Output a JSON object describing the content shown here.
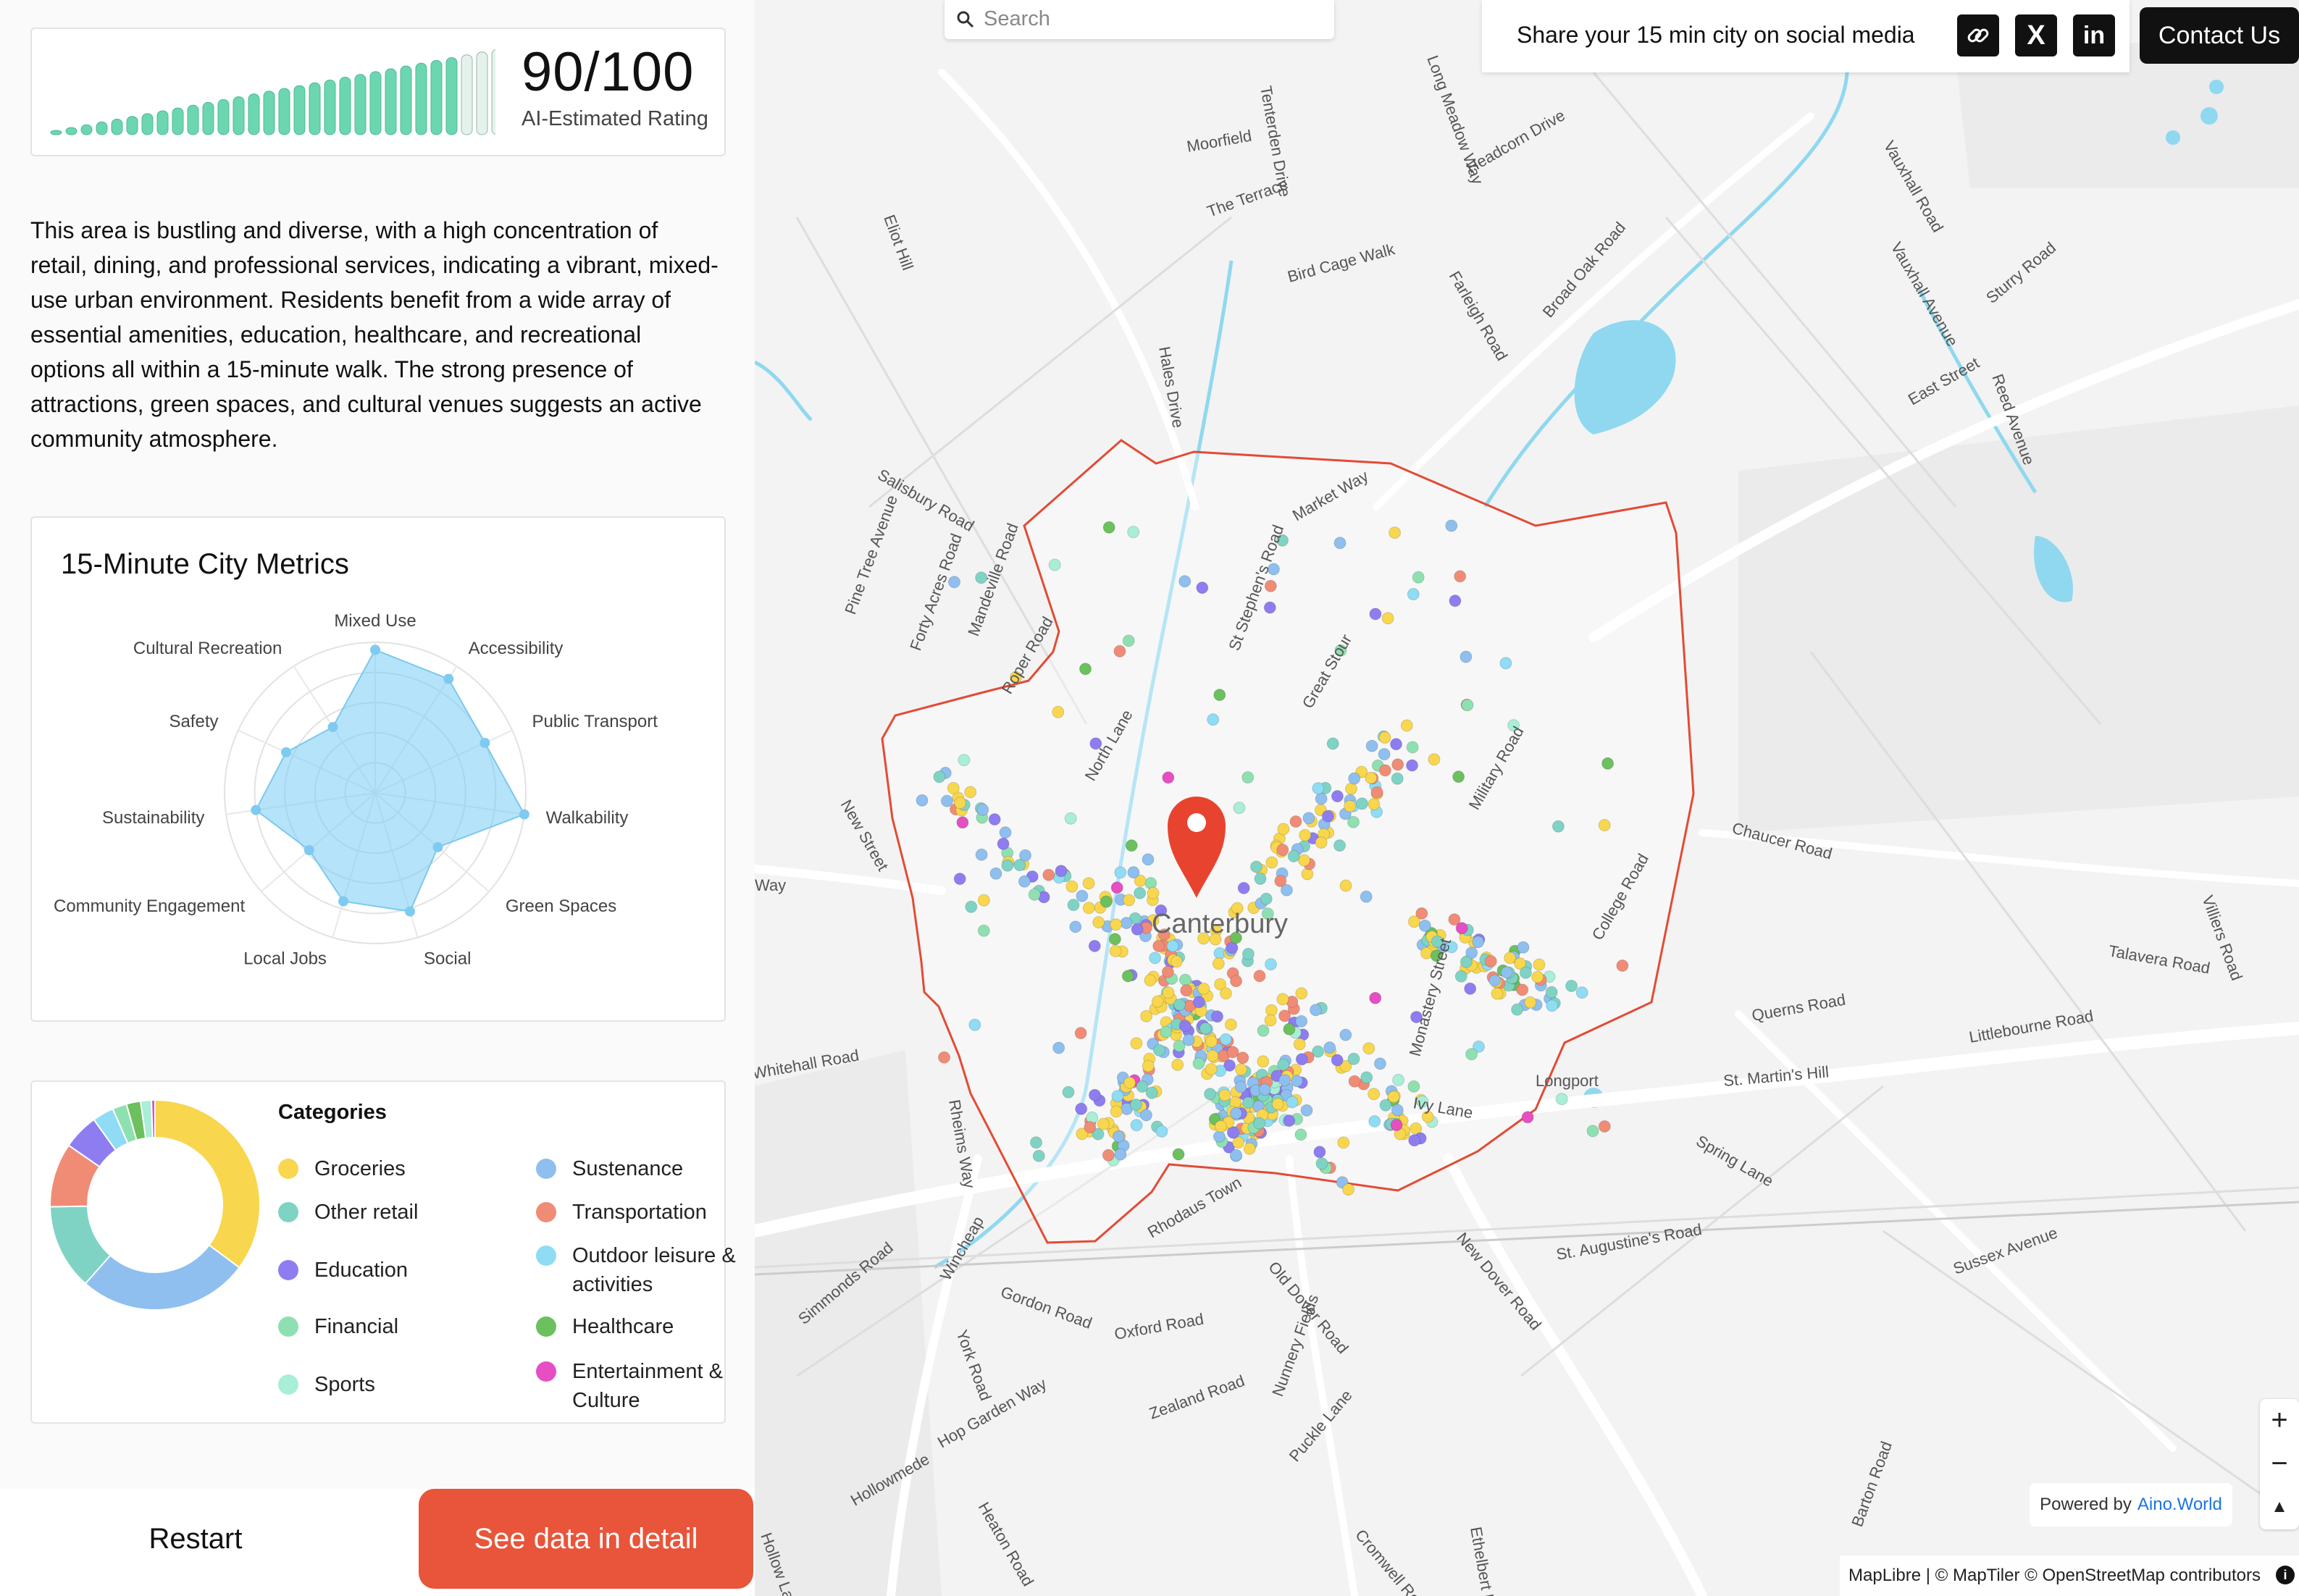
{
  "rating": {
    "score": "90/100",
    "label": "AI-Estimated Rating",
    "bars_filled_fraction": 0.9
  },
  "description": "This area is bustling and diverse, with a high concentration of retail, dining, and professional services, indicating a vibrant, mixed-use urban environment. Residents benefit from a wide array of essential amenities, education, healthcare, and recreational options all within a 15-minute walk. The strong presence of attractions, green spaces, and cultural venues suggests an active community atmosphere.",
  "chart_data": [
    {
      "type": "radar",
      "title": "15-Minute City Metrics",
      "categories": [
        "Mixed Use",
        "Accessibility",
        "Public Transport",
        "Walkability",
        "Green Spaces",
        "Social",
        "Local Jobs",
        "Community Engagement",
        "Sustainability",
        "Safety",
        "Cultural Recreation"
      ],
      "values": [
        0.95,
        0.9,
        0.8,
        1.0,
        0.55,
        0.82,
        0.75,
        0.58,
        0.8,
        0.65,
        0.52
      ],
      "range": [
        0,
        1
      ]
    },
    {
      "type": "pie",
      "title": "Categories",
      "categories": [
        "Groceries",
        "Sustenance",
        "Other retail",
        "Transportation",
        "Education",
        "Outdoor leisure & activities",
        "Financial",
        "Healthcare",
        "Sports",
        "Entertainment & Culture"
      ],
      "values": [
        32,
        24,
        12,
        9,
        5,
        3,
        2,
        2,
        1.5,
        0.5
      ],
      "colors": [
        "#f8d64e",
        "#8ebfee",
        "#7fd3c4",
        "#f08c76",
        "#8e7df0",
        "#8fdcf4",
        "#8fe0b0",
        "#6cc05e",
        "#a9eed6",
        "#e54fc3"
      ]
    }
  ],
  "categories_legend": [
    {
      "label": "Groceries",
      "color": "#f8d64e"
    },
    {
      "label": "Sustenance",
      "color": "#8ebfee"
    },
    {
      "label": "Other retail",
      "color": "#7fd3c4"
    },
    {
      "label": "Transportation",
      "color": "#f08c76"
    },
    {
      "label": "Education",
      "color": "#8e7df0"
    },
    {
      "label": "Outdoor leisure & activities",
      "color": "#8fdcf4"
    },
    {
      "label": "Financial",
      "color": "#8fe0b0"
    },
    {
      "label": "Healthcare",
      "color": "#6cc05e"
    },
    {
      "label": "Sports",
      "color": "#a9eed6"
    },
    {
      "label": "Entertainment & Culture",
      "color": "#e54fc3"
    }
  ],
  "buttons": {
    "restart": "Restart",
    "detail": "See data in detail",
    "contact": "Contact Us"
  },
  "search": {
    "placeholder": "Search"
  },
  "share": {
    "text": "Share your 15 min city on social media",
    "x_icon": "X",
    "linkedin_icon": "in"
  },
  "map": {
    "city_label": "Canterbury",
    "streets": [
      "Moorfield",
      "The Terrace",
      "Bird Cage Walk",
      "Tenterden Drive",
      "Long Meadow Way",
      "Headcorn Drive",
      "Farleigh Road",
      "Broad Oak Road",
      "Eliot Hill",
      "Hales Drive",
      "Salisbury Road",
      "Vauxhall Road",
      "Vauxhall Avenue",
      "Sturry Road",
      "Reed Avenue",
      "East Street",
      "Market Way",
      "St Stephen's Road",
      "Forty Acres Road",
      "Mandeville Road",
      "Pine Tree Avenue",
      "Roper Road",
      "North Lane",
      "New Street",
      "Chaucer Road",
      "Villiers Road",
      "Military Road",
      "College Road",
      "Talavera Road",
      "Querns Road",
      "Whitehall Road",
      "Rheims Way",
      "Monastery Street",
      "Littlebourne Road",
      "St. Martin's Hill",
      "Ivy Lane",
      "Longport",
      "Spring Lane",
      "Sussex Avenue",
      "New Dover Road",
      "St. Augustine's Road",
      "Rhodaus Town",
      "Old Dover Road",
      "Gordon Road",
      "Wincheap",
      "York Road",
      "Oxford Road",
      "Simmonds Road",
      "Zealand Road",
      "Nunnery Fields",
      "Hop Garden Way",
      "Heaton Road",
      "Puckle Lane",
      "Cromwell Road",
      "Hollowmede",
      "Hollow Lane",
      "Ethelbert Road",
      "Barton Road",
      "Great Stour",
      "Way"
    ],
    "accent_colors": {
      "boundary": "#e34b35",
      "pin": "#e8432f",
      "water": "#8fd8f0"
    }
  },
  "zoom": {
    "in": "+",
    "out": "−",
    "compass": "▲"
  },
  "powered_by": {
    "label": "Powered by",
    "link": "Aino.World"
  },
  "attribution": {
    "text": "MapLibre | © MapTiler © OpenStreetMap contributors",
    "info": "i"
  }
}
